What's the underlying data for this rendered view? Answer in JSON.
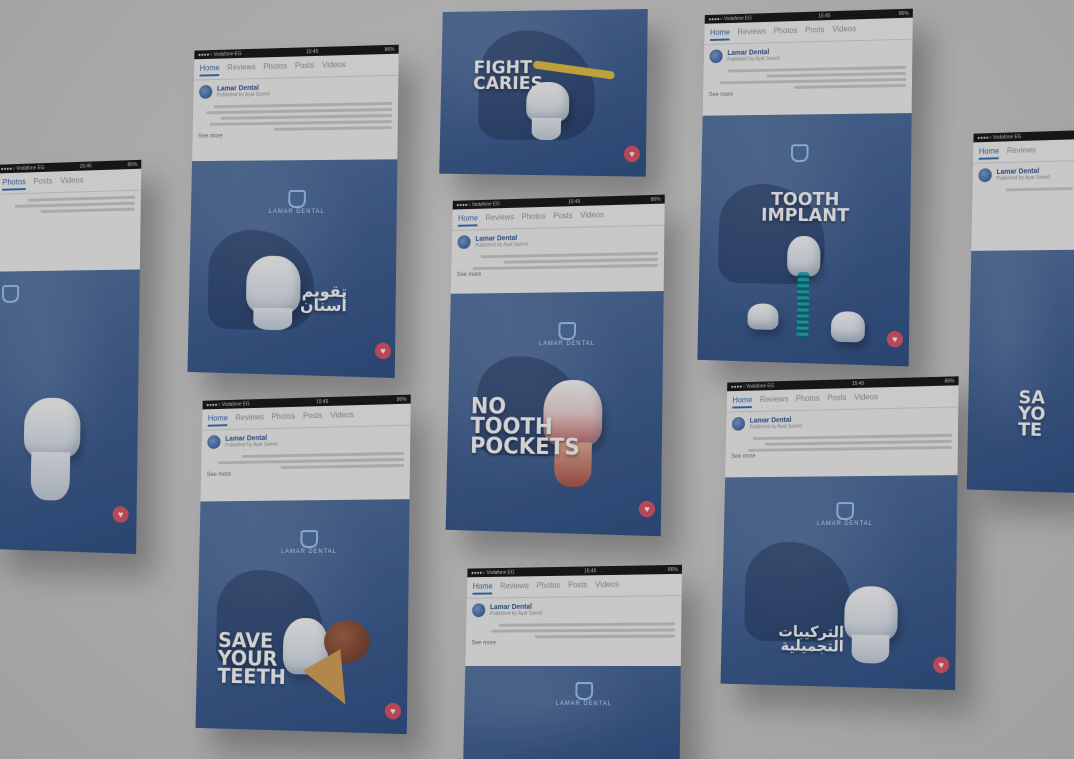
{
  "status": {
    "carrier": "●●●●○ Vodafone EG",
    "time": "15:45",
    "battery": "86%"
  },
  "tabs": [
    "Home",
    "Reviews",
    "Photos",
    "Posts",
    "Videos"
  ],
  "page": {
    "name": "Lamar Dental",
    "publisher": "Published by Ayat Saeed",
    "see_more": "See more"
  },
  "brand": {
    "logo_text": "LAMAR DENTAL"
  },
  "posts": {
    "fight": {
      "headline": "FIGHT\nCARIES"
    },
    "braces": {
      "headline": "تقويم\nأسنان"
    },
    "implant": {
      "headline": "TOOTH\nIMPLANT"
    },
    "pockets": {
      "headline": "NO\nTOOTH\nPOCKETS"
    },
    "save": {
      "headline": "SAVE\nYOUR\nTEETH"
    },
    "cosmetic": {
      "headline": "التركيبات\nالتجميلية"
    },
    "edge_left": {
      "headline": ""
    },
    "edge_right": {
      "headline": "SA\nYO\nTE"
    }
  },
  "colors": {
    "accent": "#3b6fb6",
    "poster": "#46669a",
    "heart": "#e0586b"
  }
}
